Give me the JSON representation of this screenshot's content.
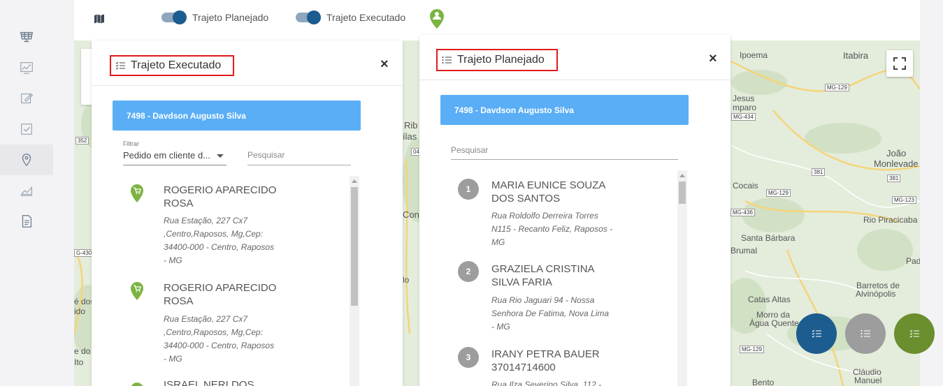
{
  "colors": {
    "accent": "#1c5c8f",
    "driver_button": "#5aaef5",
    "title_highlight": "#e01b1b",
    "pin_green": "#7cb342",
    "fab_blue": "#1c5c8f",
    "fab_gray": "#9d9d9d",
    "fab_green": "#6b8e2e"
  },
  "sidebar": {
    "items": [
      {
        "icon": "solar-panel-icon"
      },
      {
        "icon": "chart-icon"
      },
      {
        "icon": "edit-icon"
      },
      {
        "icon": "checkbox-icon"
      },
      {
        "icon": "location-pin-icon",
        "active": true
      },
      {
        "icon": "area-chart-icon"
      },
      {
        "icon": "document-icon"
      }
    ]
  },
  "toolbar": {
    "map_icon": "map-icon",
    "toggle_planned_label": "Trajeto Planejado",
    "toggle_executed_label": "Trajeto Executado",
    "user_pin_icon": "user-pin-icon"
  },
  "executed_panel": {
    "title": "Trajeto Executado",
    "driver": "7498 - Davdson Augusto Silva",
    "filter_label": "Filtrar",
    "filter_value": "Pedido em cliente d...",
    "search_placeholder": "Pesquisar",
    "items": [
      {
        "name1": "ROGERIO APARECIDO",
        "name2": "ROSA",
        "addr": [
          "Rua Estação, 227 Cx7",
          ",Centro,Raposos, Mg,Cep:",
          "34400-000 - Centro, Raposos",
          "- MG"
        ]
      },
      {
        "name1": "ROGERIO APARECIDO",
        "name2": "ROSA",
        "addr": [
          "Rua Estação, 227 Cx7",
          ",Centro,Raposos, Mg,Cep:",
          "34400-000 - Centro, Raposos",
          "- MG"
        ]
      },
      {
        "name1": "ISRAEL NERI DOS"
      }
    ]
  },
  "planned_panel": {
    "title": "Trajeto Planejado",
    "driver": "7498 - Davdson Augusto Silva",
    "search_placeholder": "Pesquisar",
    "items": [
      {
        "num": "1",
        "name1": "MARIA EUNICE SOUZA",
        "name2": "DOS SANTOS",
        "addr": [
          "Rua Roldolfo Derreira Torres",
          "N115 - Recanto Feliz, Raposos -",
          "MG"
        ]
      },
      {
        "num": "2",
        "name1": "GRAZIELA CRISTINA",
        "name2": "SILVA FARIA",
        "addr": [
          "Rua Rio Jaguari 94 - Nossa",
          "Senhora De Fatima, Nova Lima",
          "- MG"
        ]
      },
      {
        "num": "3",
        "name1": "IRANY PETRA BAUER",
        "name2": "37014714600",
        "addr": [
          "Rua Ilza Severino Silva, 112 -"
        ]
      }
    ]
  },
  "map": {
    "labels": [
      "Ipoema",
      "Itabira",
      "Jesus",
      "mparo",
      "João",
      "Monlevade",
      "Cocais",
      "Rio Piracicaba",
      "Santa Bárbara",
      "Brumal",
      "Pad",
      "Barretos de",
      "Alvinópolis",
      "Catas Altas",
      "Morro da",
      "Água Quente",
      "Cláudio",
      "Manuel",
      "Bento",
      "Rib",
      "ílas",
      "Con",
      "lo",
      "é dos",
      "ido",
      "e do",
      "Ito"
    ],
    "roads": [
      "MG-129",
      "MG-434",
      "381",
      "MG-129",
      "381",
      "MG-123",
      "MG-436",
      "MG-129",
      "352",
      "G-430",
      "046"
    ]
  },
  "fabs": [
    {
      "icon": "list-check-icon"
    },
    {
      "icon": "list-icon"
    },
    {
      "icon": "list-check-icon"
    }
  ]
}
